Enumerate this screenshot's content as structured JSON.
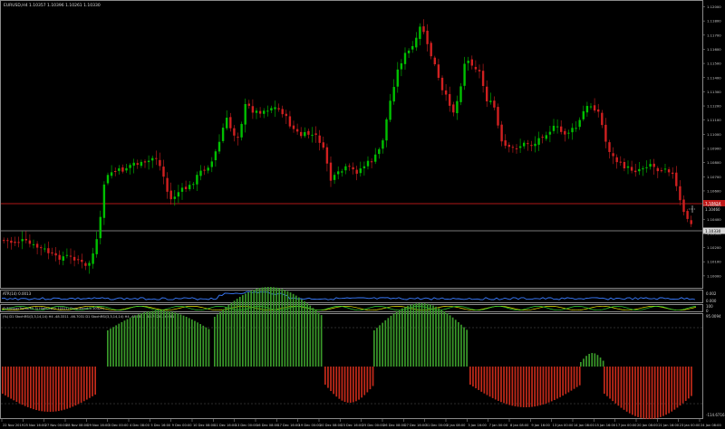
{
  "window": {
    "title": "EURUSD,H4",
    "ohlc_label": "EURUSD,H4  1.10357 1.10396 1.10261 1.10330"
  },
  "main_panel": {
    "price_axis_labels": [
      "1.12000",
      "1.11800",
      "1.11700",
      "1.11600",
      "1.11500",
      "1.11400",
      "1.11300",
      "1.11200",
      "1.11100",
      "1.11000",
      "1.10900",
      "1.10800",
      "1.10700",
      "1.10600",
      "1.10500",
      "1.10400",
      "1.10300",
      "1.10200",
      "1.10100",
      "1.10000"
    ],
    "price_marker": "1.10330",
    "level_marker": "1.10624",
    "cursor_marker": "1.10460",
    "up_color": "#00c000",
    "down_color": "#d02020"
  },
  "indicator_atr": {
    "label": "ATR(14) 0.0013",
    "axis_top": "0.002",
    "axis_bottom": "0.000"
  },
  "indicator_stoch": {
    "label": "SVMSuperTrend(50,3) HighLow(1.10311) DownTrend(1.10329)",
    "axis_top": "100",
    "axis_bottom": "0"
  },
  "indicator_hist": {
    "label": "(%) D1 StochRSI(3,3,14,14) H4 -48.3311 -46.7031 D1 StochRSI(3,3,14,14) H4 -48.0813 -46.7026 -46.6811",
    "axis_top": "95.0094",
    "axis_bottom": "-114.6716"
  },
  "time_axis_labels": [
    "22 Nov 2019",
    "25 Nov 16:00",
    "27 Nov 00:00",
    "28 Nov 08:00",
    "29 Nov 16:00",
    "3 Dec 00:00",
    "4 Dec 08:00",
    "5 Dec 16:00",
    "9 Dec 00:00",
    "10 Dec 08:00",
    "11 Dec 16:00",
    "13 Dec 00:00",
    "16 Dec 08:00",
    "17 Dec 16:00",
    "19 Dec 00:00",
    "20 Dec 08:00",
    "23 Dec 16:00",
    "25 Dec 00:00",
    "26 Dec 08:00",
    "27 Dec 16:00",
    "31 Dec 00:00",
    "2 Jan 08:00",
    "3 Jan 16:00",
    "7 Jan 00:00",
    "8 Jan 08:00",
    "9 Jan 16:00",
    "13 Jan 00:00",
    "14 Jan 08:00",
    "15 Jan 16:00",
    "17 Jan 00:00",
    "20 Jan 08:00",
    "21 Jan 16:00",
    "23 Jan 00:00",
    "24 Jan 08:00"
  ]
}
